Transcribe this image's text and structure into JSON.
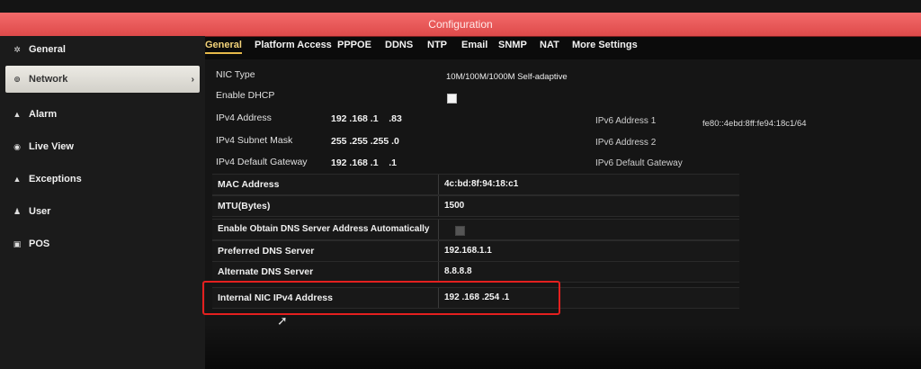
{
  "window": {
    "title": "Configuration"
  },
  "sidebar": {
    "items": [
      {
        "label": "General",
        "icon": "gear-icon"
      },
      {
        "label": "Network",
        "icon": "network-icon",
        "active": true
      },
      {
        "label": "Alarm",
        "icon": "alarm-icon"
      },
      {
        "label": "Live View",
        "icon": "eye-icon"
      },
      {
        "label": "Exceptions",
        "icon": "warning-icon"
      },
      {
        "label": "User",
        "icon": "user-icon"
      },
      {
        "label": "POS",
        "icon": "pos-icon"
      }
    ]
  },
  "tabs": [
    {
      "label": "General",
      "active": true
    },
    {
      "label": "Platform Access"
    },
    {
      "label": "PPPOE"
    },
    {
      "label": "DDNS"
    },
    {
      "label": "NTP"
    },
    {
      "label": "Email"
    },
    {
      "label": "SNMP"
    },
    {
      "label": "NAT"
    },
    {
      "label": "More Settings"
    }
  ],
  "general": {
    "nic_type_label": "NIC Type",
    "nic_type_value": "10M/100M/1000M Self-adaptive",
    "dhcp_label": "Enable DHCP",
    "ipv4_address_label": "IPv4 Address",
    "ipv4_address_value": "192 .168 .1    .83",
    "ipv4_mask_label": "IPv4 Subnet Mask",
    "ipv4_mask_value": "255 .255 .255 .0",
    "ipv4_gateway_label": "IPv4 Default Gateway",
    "ipv4_gateway_value": "192 .168 .1    .1",
    "ipv6_address1_label": "IPv6 Address 1",
    "ipv6_address1_value": "fe80::4ebd:8ff:fe94:18c1/64",
    "ipv6_address2_label": "IPv6 Address 2",
    "ipv6_gateway_label": "IPv6 Default Gateway"
  },
  "rows": [
    {
      "label": "MAC Address",
      "value": "4c:bd:8f:94:18:c1"
    },
    {
      "label": "MTU(Bytes)",
      "value": "1500"
    },
    {
      "label": "Enable Obtain DNS Server Address Automatically",
      "value": ""
    },
    {
      "label": "Preferred DNS Server",
      "value": "192.168.1.1"
    },
    {
      "label": "Alternate DNS Server",
      "value": "8.8.8.8"
    },
    {
      "label": "Internal NIC IPv4 Address",
      "value": "192 .168 .254 .1"
    }
  ]
}
